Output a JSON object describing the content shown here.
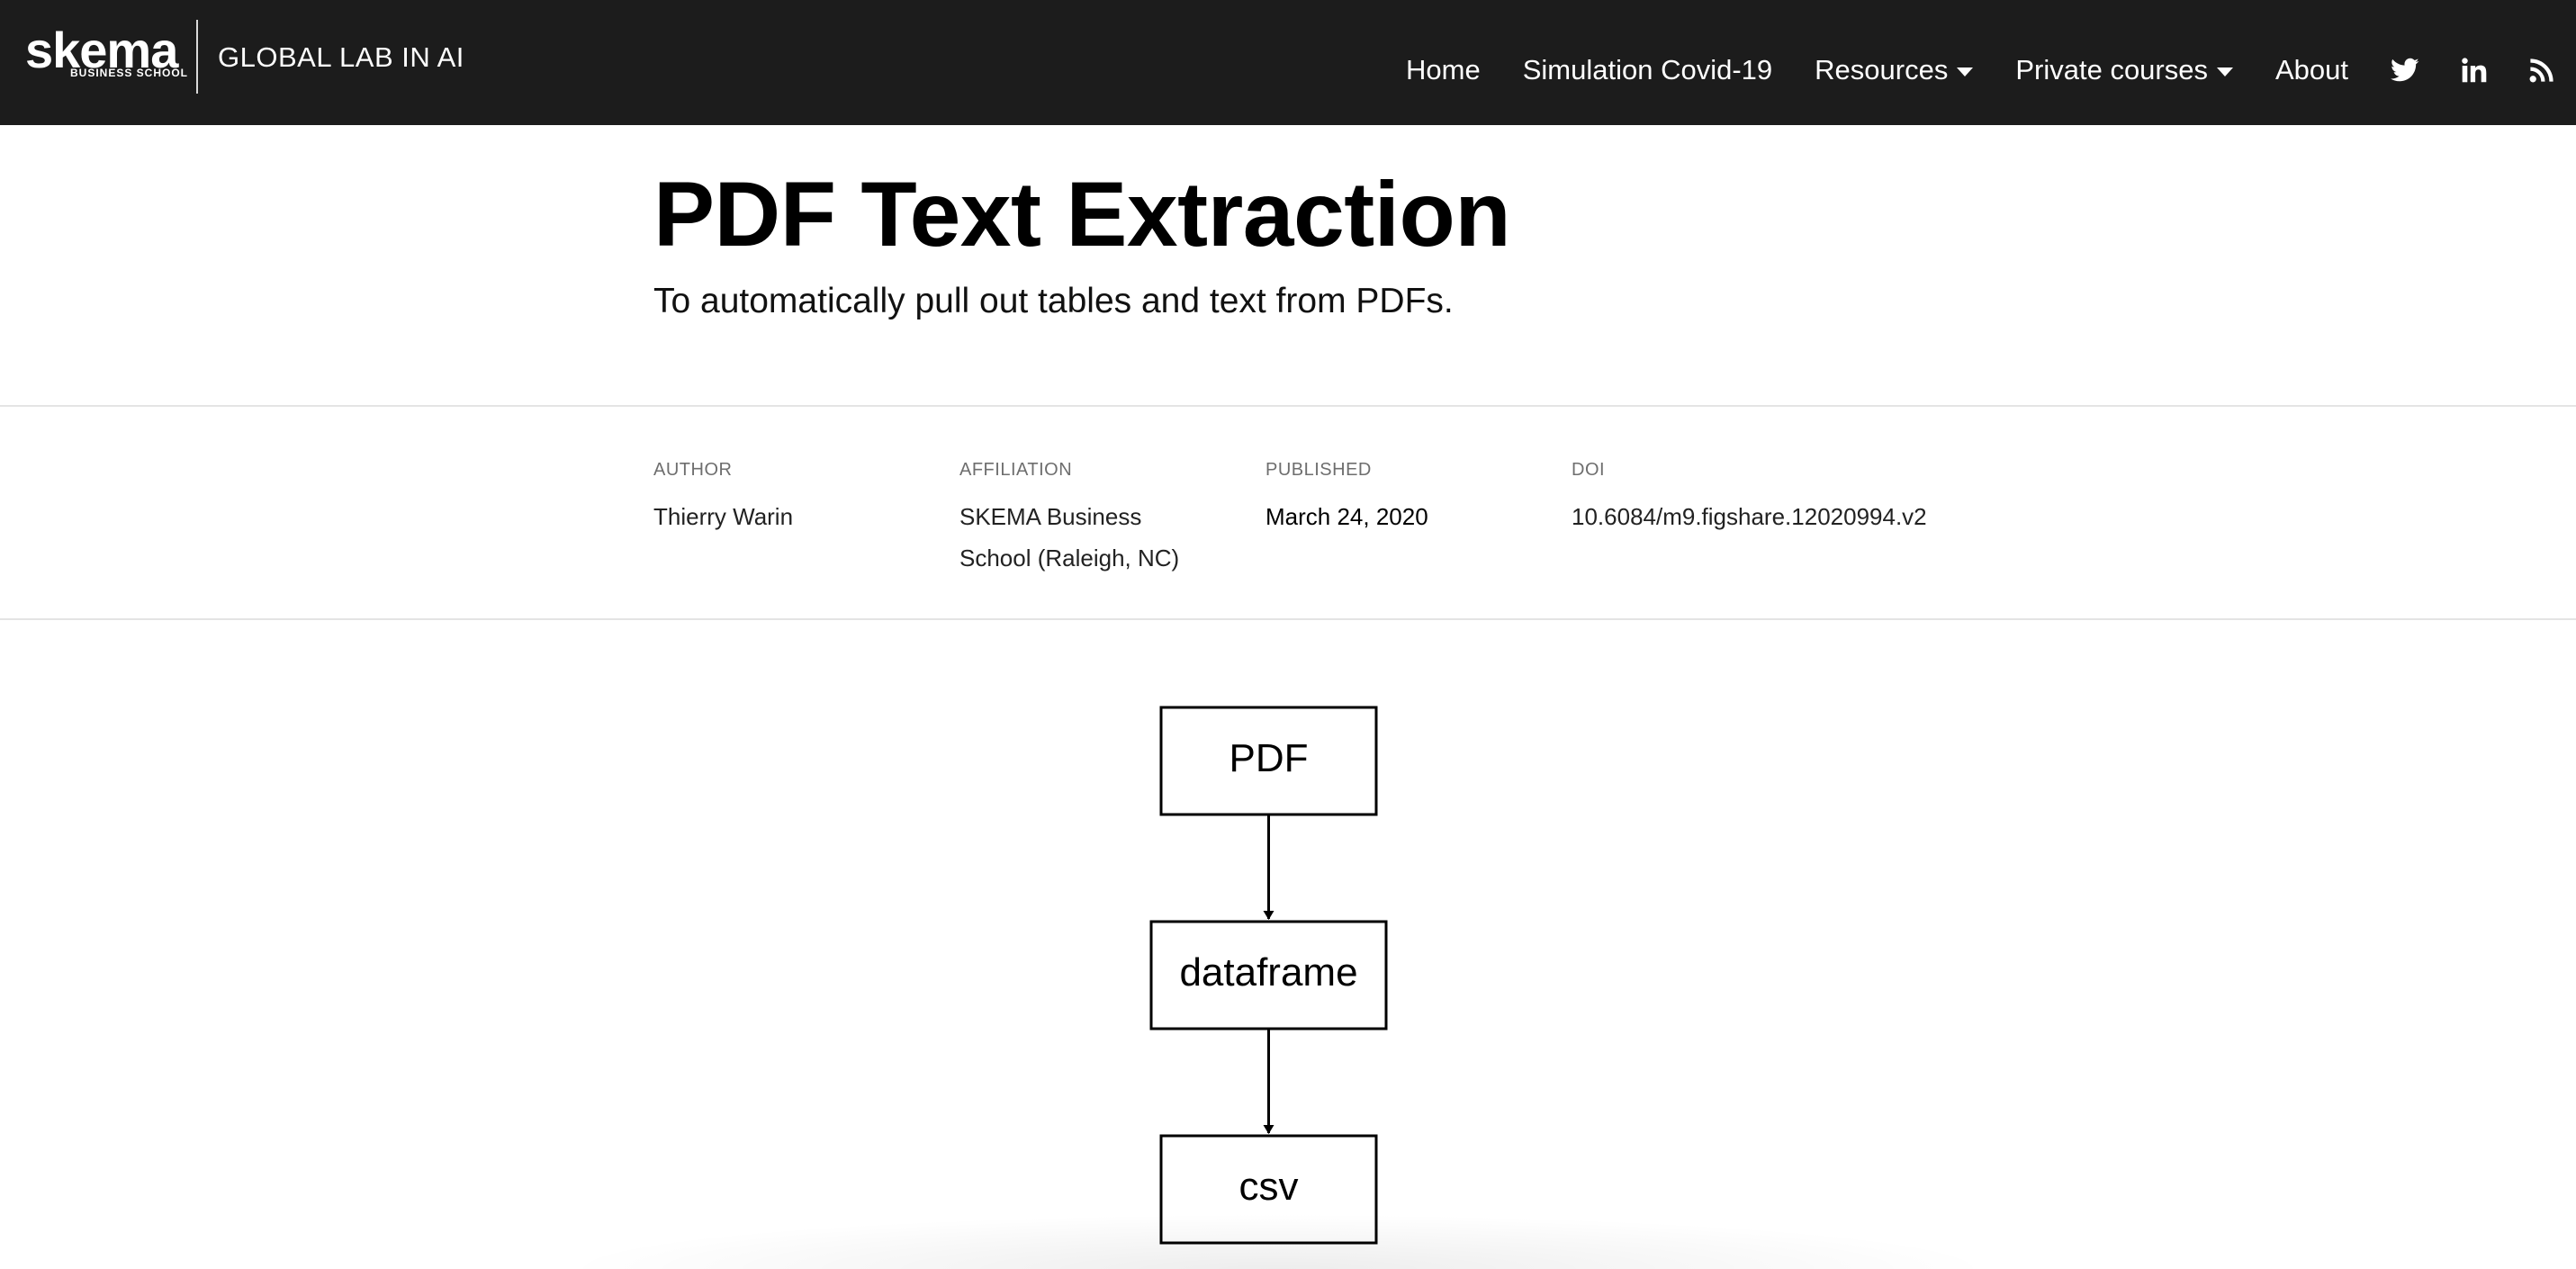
{
  "header": {
    "logo": {
      "word": "skema",
      "sub": "BUSINESS SCHOOL"
    },
    "lab_name": "GLOBAL LAB IN AI",
    "nav": [
      {
        "label": "Home"
      },
      {
        "label": "Simulation Covid-19"
      },
      {
        "label": "Resources",
        "dropdown": true
      },
      {
        "label": "Private courses",
        "dropdown": true
      },
      {
        "label": "About"
      }
    ],
    "social_icons": [
      "twitter-icon",
      "linkedin-icon",
      "rss-icon"
    ],
    "colors": {
      "background": "#1c1c1c",
      "text": "#ffffff"
    }
  },
  "article": {
    "title": "PDF Text Extraction",
    "subtitle": "To automatically pull out tables and text from PDFs.",
    "byline": {
      "author_label": "AUTHOR",
      "author": "Thierry Warin",
      "affiliation_label": "AFFILIATION",
      "affiliation_line1": "SKEMA Business",
      "affiliation_line2": "School (Raleigh, NC)",
      "published_label": "PUBLISHED",
      "published": "March 24, 2020",
      "doi_label": "DOI",
      "doi": "10.6084/m9.figshare.12020994.v2"
    }
  },
  "diagram": {
    "nodes": [
      "PDF",
      "dataframe",
      "csv"
    ],
    "edges": [
      [
        "PDF",
        "dataframe"
      ],
      [
        "dataframe",
        "csv"
      ]
    ]
  }
}
